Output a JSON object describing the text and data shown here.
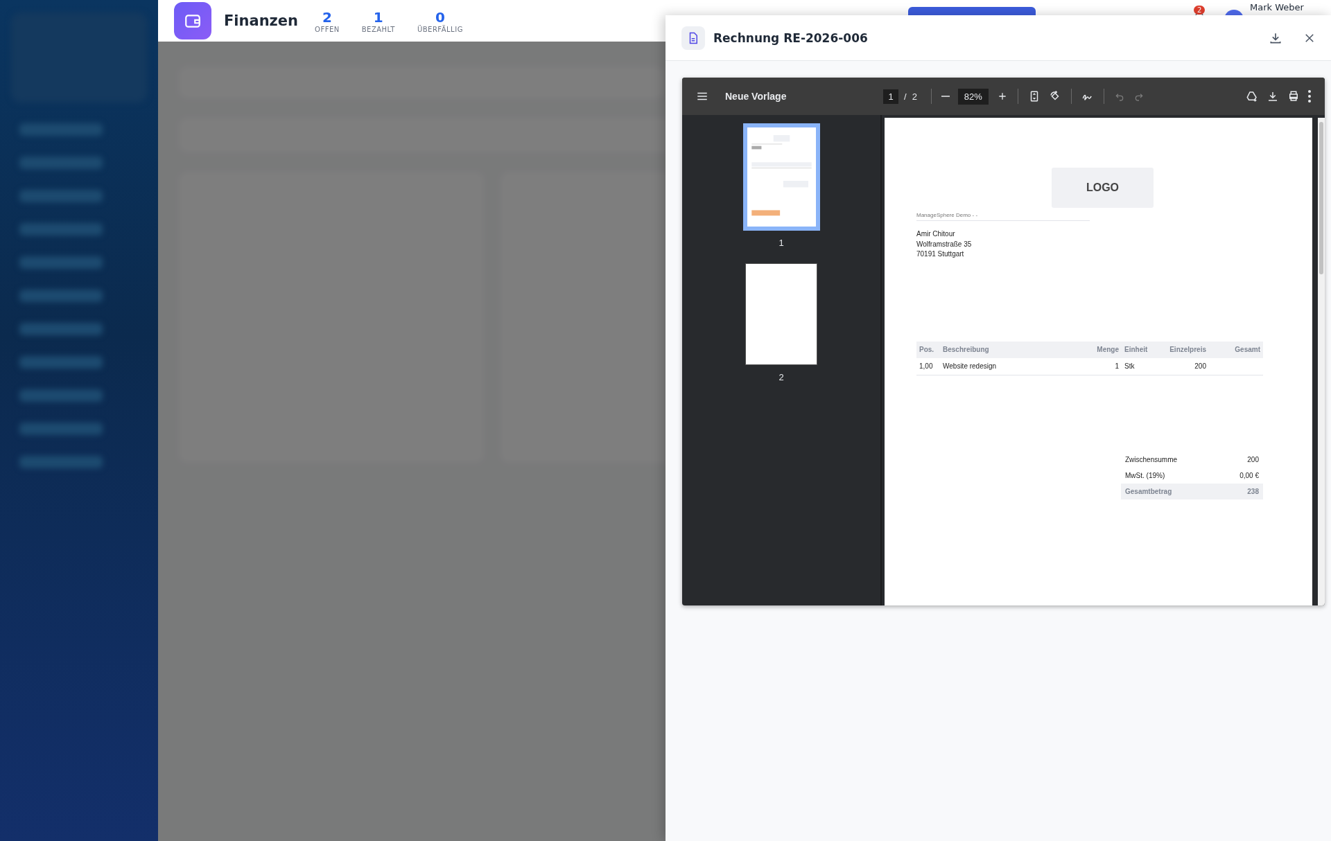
{
  "header": {
    "title": "Finanzen",
    "stats": [
      {
        "value": "2",
        "label": "OFFEN"
      },
      {
        "value": "1",
        "label": "BEZAHLT"
      },
      {
        "value": "0",
        "label": "ÜBERFÄLLIG"
      }
    ],
    "notification_count": "2",
    "user_name": "Mark Weber"
  },
  "drawer": {
    "title": "Rechnung RE-2026-006"
  },
  "pdf_viewer": {
    "document_title": "Neue Vorlage",
    "current_page": "1",
    "page_separator": "/",
    "page_count": "2",
    "zoom": "82%",
    "undo_disabled": true,
    "redo_disabled": true,
    "thumbnails": [
      {
        "label": "1",
        "selected": true
      },
      {
        "label": "2",
        "selected": false
      }
    ],
    "page": {
      "logo": "LOGO",
      "sender_line": "ManageSphere Demo - -",
      "recipient": [
        "Amir Chitour",
        "Wolframstraße 35",
        "70191 Stuttgart"
      ],
      "table": {
        "columns": [
          "Pos.",
          "Beschreibung",
          "Menge",
          "Einheit",
          "Einzelpreis",
          "Gesamt"
        ],
        "rows": [
          [
            "1,00",
            "Website redesign",
            "1",
            "Stk",
            "200"
          ]
        ]
      },
      "totals": [
        {
          "kind": "line",
          "label": "Zwischensumme",
          "value": "200"
        },
        {
          "kind": "line",
          "label": "MwSt. (19%)",
          "value": "0,00 €"
        },
        {
          "kind": "grand",
          "label": "Gesamtbetrag",
          "value": "238"
        }
      ]
    }
  }
}
